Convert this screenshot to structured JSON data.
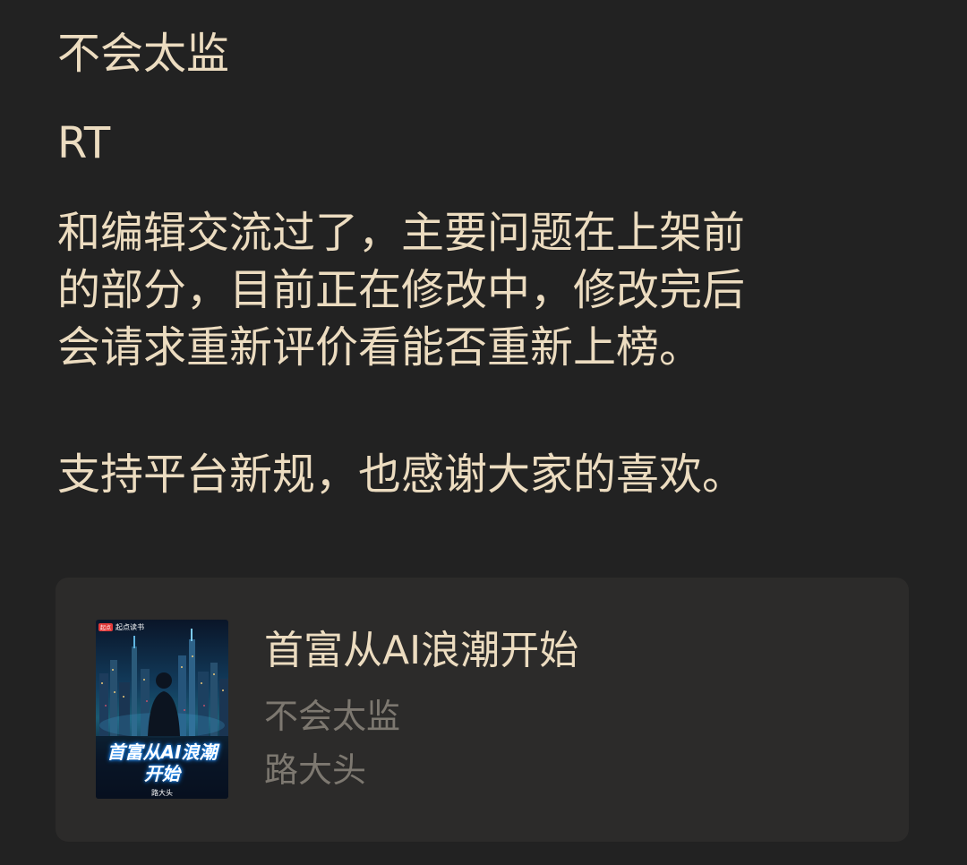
{
  "post": {
    "author": "不会太监",
    "title": "RT",
    "paragraph1": [
      "和编辑交流过了，主要问题在上架前",
      "的部分，目前正在修改中，修改完后",
      "会请求重新评价看能否重新上榜。"
    ],
    "paragraph2": "支持平台新规，也感谢大家的喜欢。"
  },
  "book_card": {
    "title": "首富从AI浪潮开始",
    "author": "不会太监",
    "pen_name": "路大头",
    "cover": {
      "brand_badge": "起点",
      "brand": "起点读书",
      "title_line1": "首富从AI浪潮",
      "title_line2": "开始",
      "author": "路大头"
    }
  }
}
